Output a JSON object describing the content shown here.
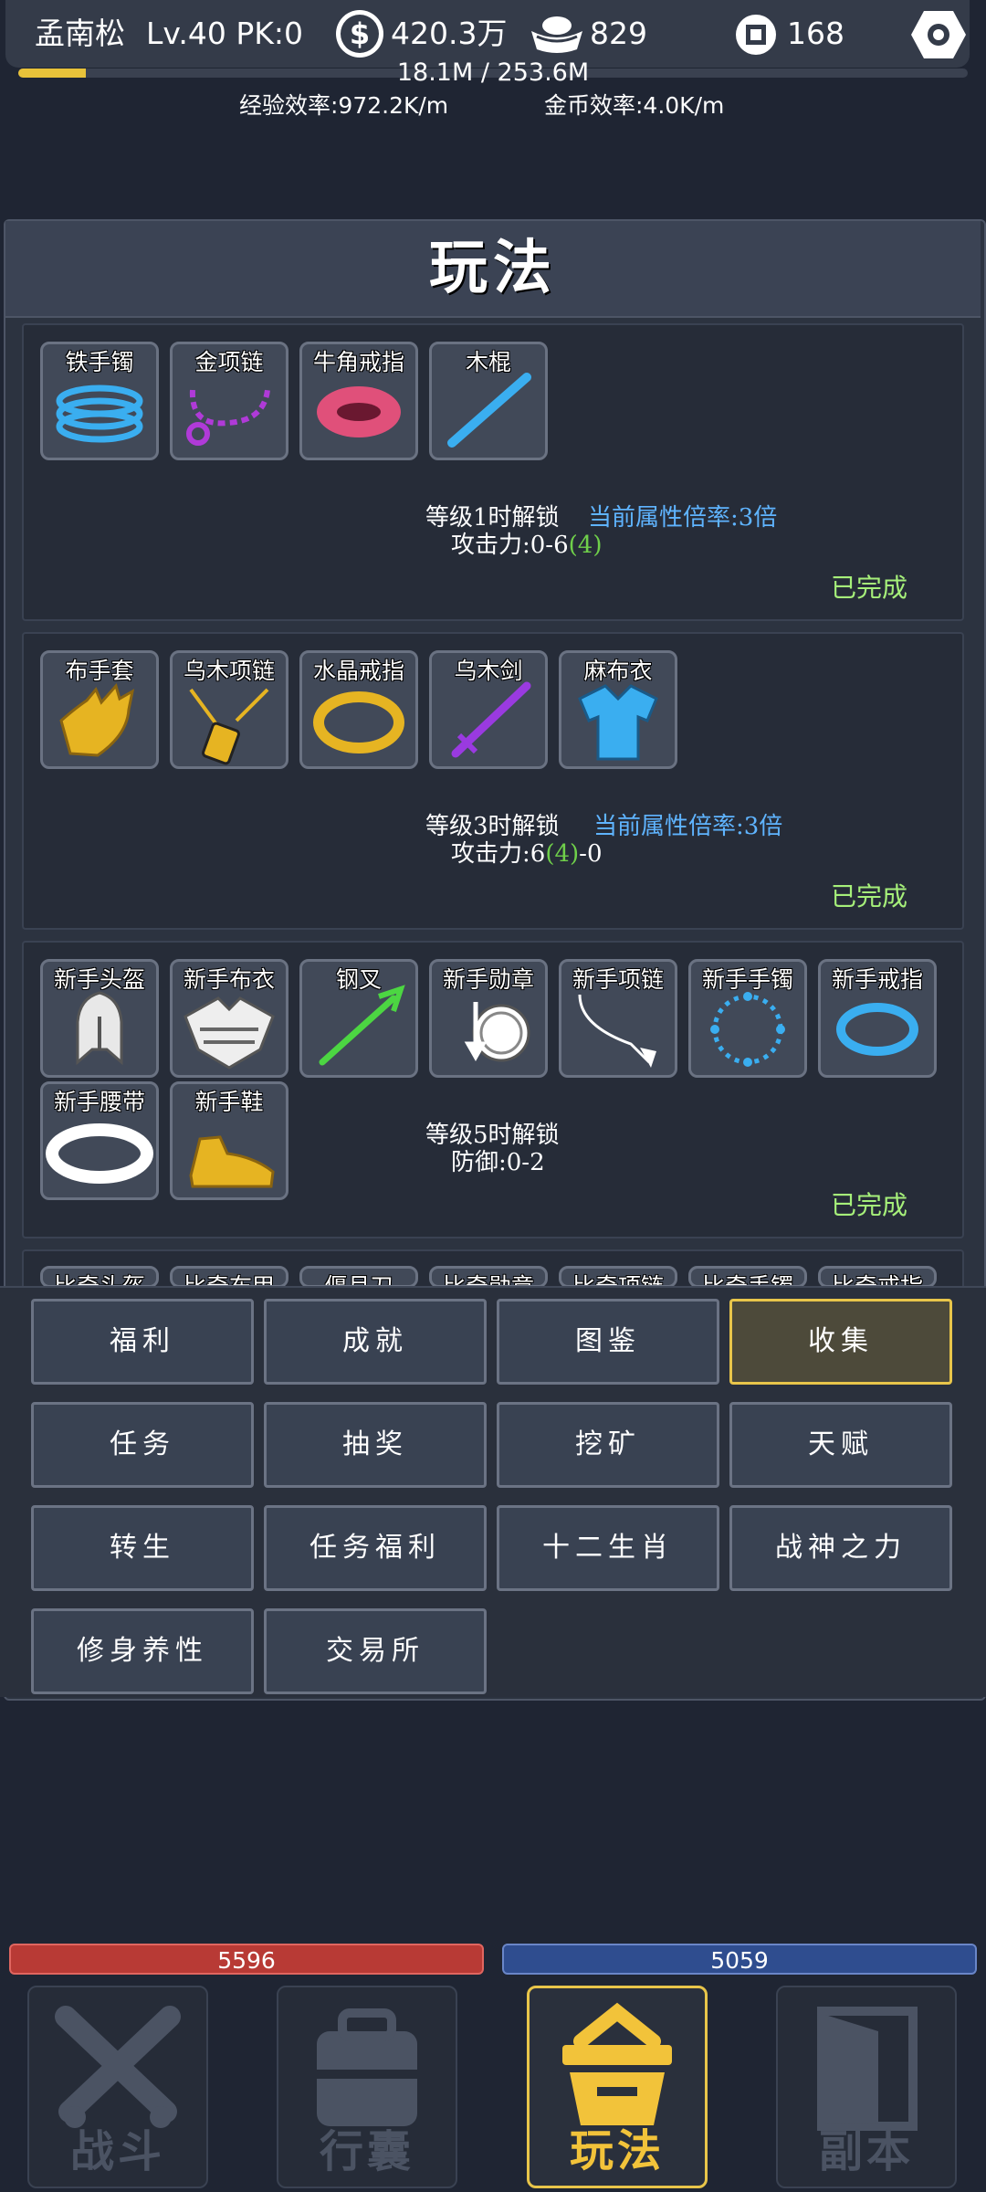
{
  "header": {
    "player_name": "孟南松",
    "level_pk": "Lv.40 PK:0",
    "coins": "420.3万",
    "ingots": "829",
    "tokens": "168",
    "exp_progress_text": "18.1M / 253.6M",
    "exp_fraction": 0.071,
    "exp_rate": "经验效率:972.2K/m",
    "gold_rate": "金币效率:4.0K/m"
  },
  "panel": {
    "title": "玩法",
    "sets": [
      {
        "items": [
          "铁手镯",
          "金项链",
          "牛角戒指",
          "木棍"
        ],
        "unlock": "等级1时解锁",
        "multiplier": "当前属性倍率:3倍",
        "stat_prefix": "攻击力:0-6",
        "stat_bonus": "(4)",
        "stat_suffix": "",
        "status": "已完成"
      },
      {
        "items": [
          "布手套",
          "乌木项链",
          "水晶戒指",
          "乌木剑",
          "麻布衣"
        ],
        "unlock": "等级3时解锁",
        "multiplier": "当前属性倍率:3倍",
        "stat_prefix": "攻击力:6",
        "stat_bonus": "(4)",
        "stat_suffix": "-0",
        "status": "已完成"
      },
      {
        "items": [
          "新手头盔",
          "新手布衣",
          "钢叉",
          "新手勋章",
          "新手项链",
          "新手手镯",
          "新手戒指",
          "新手腰带",
          "新手鞋"
        ],
        "unlock": "等级5时解锁",
        "stat": "防御:0-2",
        "status": "已完成"
      }
    ],
    "partial_items": [
      "比奇头盔",
      "比奇布甲",
      "偃月刀",
      "比奇勋章",
      "比奇项链",
      "比奇手镯",
      "比奇戒指"
    ]
  },
  "menu": {
    "buttons": [
      "福利",
      "成就",
      "图鉴",
      "收集",
      "任务",
      "抽奖",
      "挖矿",
      "天赋",
      "转生",
      "任务福利",
      "十二生肖",
      "战神之力",
      "修身养性",
      "交易所"
    ],
    "active": "收集"
  },
  "status": {
    "hp": "5596",
    "mp": "5059"
  },
  "nav": {
    "tabs": [
      "战斗",
      "行囊",
      "玩法",
      "副本"
    ],
    "active": "玩法"
  },
  "colors": {
    "accent": "#e8c54a",
    "hp": "#b83a35",
    "mp": "#2f4d8f",
    "multiplier": "#5fb4ff",
    "done": "#a6f07a"
  }
}
